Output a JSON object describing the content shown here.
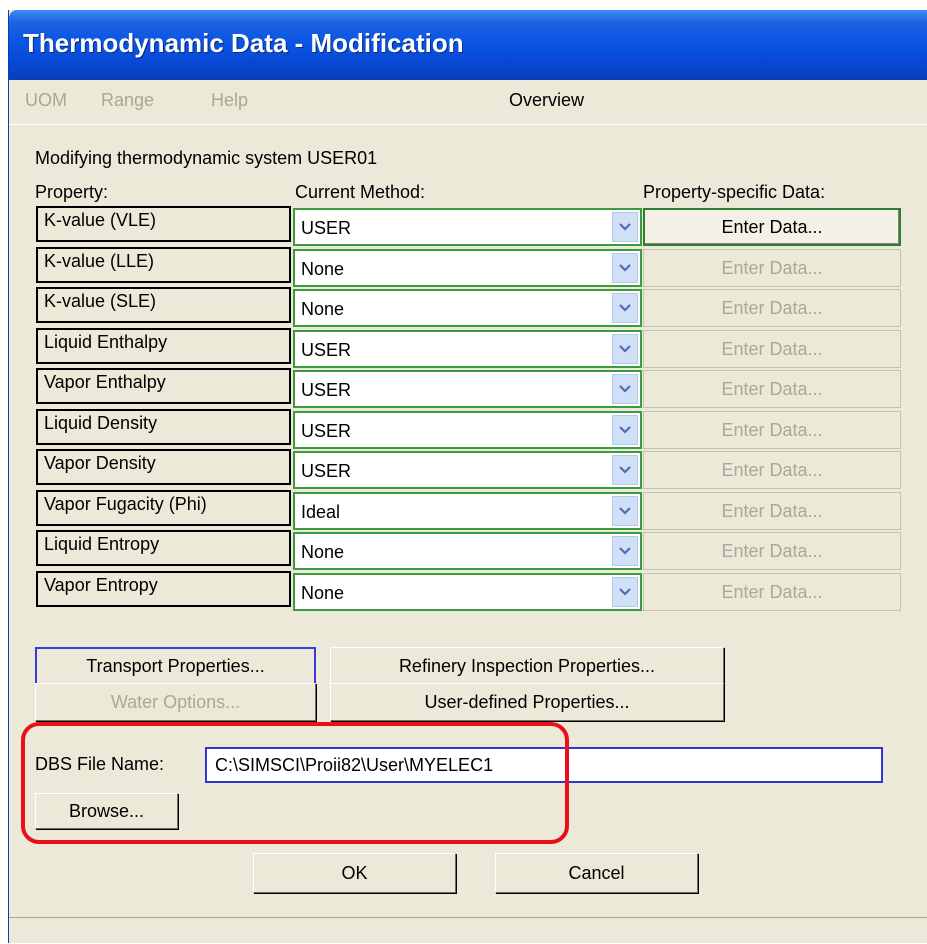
{
  "window": {
    "title": "Thermodynamic Data - Modification"
  },
  "menu": {
    "items": [
      "UOM",
      "Range",
      "Help"
    ],
    "overview": "Overview"
  },
  "header": {
    "modifying": "Modifying thermodynamic system USER01",
    "col_property": "Property:",
    "col_method": "Current Method:",
    "col_data": "Property-specific Data:"
  },
  "rows": [
    {
      "property": "K-value (VLE)",
      "method": "USER",
      "button": "Enter Data...",
      "enabled": true
    },
    {
      "property": "K-value (LLE)",
      "method": "None",
      "button": "Enter Data...",
      "enabled": false
    },
    {
      "property": "K-value (SLE)",
      "method": "None",
      "button": "Enter Data...",
      "enabled": false
    },
    {
      "property": "Liquid Enthalpy",
      "method": "USER",
      "button": "Enter Data...",
      "enabled": false
    },
    {
      "property": "Vapor Enthalpy",
      "method": "USER",
      "button": "Enter Data...",
      "enabled": false
    },
    {
      "property": "Liquid Density",
      "method": "USER",
      "button": "Enter Data...",
      "enabled": false
    },
    {
      "property": "Vapor Density",
      "method": "USER",
      "button": "Enter Data...",
      "enabled": false
    },
    {
      "property": "Vapor Fugacity (Phi)",
      "method": "Ideal",
      "button": "Enter Data...",
      "enabled": false
    },
    {
      "property": "Liquid Entropy",
      "method": "None",
      "button": "Enter Data...",
      "enabled": false
    },
    {
      "property": "Vapor Entropy",
      "method": "None",
      "button": "Enter Data...",
      "enabled": false
    }
  ],
  "buttons": {
    "transport": "Transport Properties...",
    "refinery": "Refinery Inspection Properties...",
    "water": "Water Options...",
    "user_defined": "User-defined Properties...",
    "browse": "Browse...",
    "ok": "OK",
    "cancel": "Cancel"
  },
  "dbs": {
    "label": "DBS File Name:",
    "value": "C:\\SIMSCI\\Proii82\\User\\MYELEC1"
  },
  "colors": {
    "title_bar": "#0a55e5",
    "dialog_bg": "#ece9d8",
    "highlight": "#e8101a",
    "combo_border": "#3e9a3e"
  },
  "icons": {
    "dropdown": "chevron-down-icon"
  }
}
